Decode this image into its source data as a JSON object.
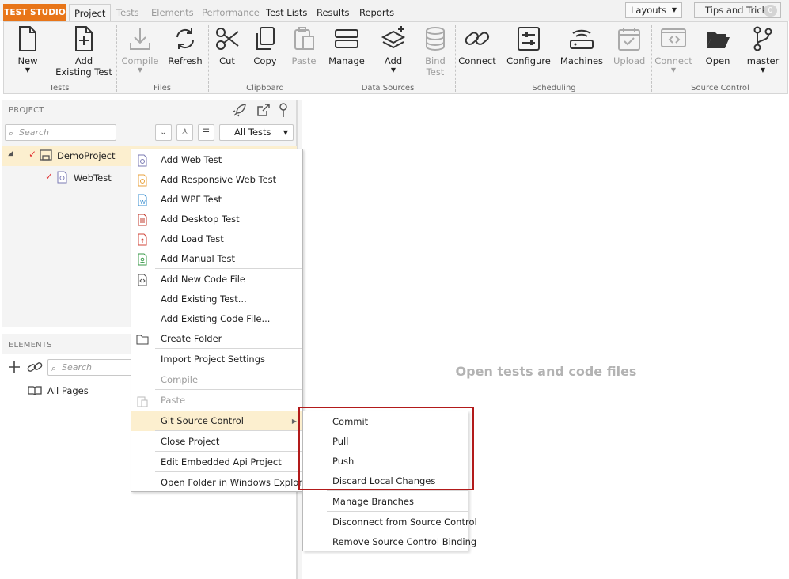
{
  "app": {
    "brand": "TEST STUDIO"
  },
  "tabs": [
    {
      "label": "Project",
      "state": "active"
    },
    {
      "label": "Tests",
      "state": "disabled"
    },
    {
      "label": "Elements",
      "state": "disabled"
    },
    {
      "label": "Performance",
      "state": "disabled"
    },
    {
      "label": "Test Lists",
      "state": "normal"
    },
    {
      "label": "Results",
      "state": "normal"
    },
    {
      "label": "Reports",
      "state": "normal"
    }
  ],
  "topright": {
    "layouts": "Layouts",
    "tips": "Tips and Tricks",
    "tips_count": "0"
  },
  "ribbon": {
    "new": "New",
    "add_existing_1": "Add",
    "add_existing_2": "Existing Test",
    "compile": "Compile",
    "refresh": "Refresh",
    "cut": "Cut",
    "copy": "Copy",
    "paste": "Paste",
    "manage": "Manage",
    "add": "Add",
    "bind_1": "Bind",
    "bind_2": "Test",
    "connect": "Connect",
    "configure": "Configure",
    "machines": "Machines",
    "upload": "Upload",
    "sc_connect": "Connect",
    "open": "Open",
    "master": "master",
    "groups": {
      "tests": "Tests",
      "files": "Files",
      "clipboard": "Clipboard",
      "data_sources": "Data Sources",
      "scheduling": "Scheduling",
      "source_control": "Source Control"
    }
  },
  "project_panel": {
    "title": "PROJECT",
    "search_placeholder": "Search",
    "filter": "All Tests",
    "tree": [
      {
        "label": "DemoProject",
        "level": 0
      },
      {
        "label": "WebTest",
        "level": 1
      }
    ]
  },
  "elements_panel": {
    "title": "ELEMENTS",
    "search_placeholder": "Search",
    "all_pages": "All Pages"
  },
  "main": {
    "placeholder": "Open tests and code files"
  },
  "context_menu": {
    "items": [
      {
        "label": "Add Web Test",
        "icon": "web-test-icon"
      },
      {
        "label": "Add Responsive Web Test",
        "icon": "responsive-test-icon"
      },
      {
        "label": "Add WPF Test",
        "icon": "wpf-test-icon"
      },
      {
        "label": "Add Desktop Test",
        "icon": "desktop-test-icon"
      },
      {
        "label": "Add Load Test",
        "icon": "load-test-icon"
      },
      {
        "label": "Add Manual Test",
        "icon": "manual-test-icon"
      },
      {
        "label": "Add New Code File",
        "icon": "code-file-icon"
      },
      {
        "label": "Add Existing Test...",
        "icon": ""
      },
      {
        "label": "Add Existing Code File...",
        "icon": ""
      },
      {
        "label": "Create Folder",
        "icon": "folder-icon"
      },
      {
        "label": "Import Project Settings",
        "icon": ""
      },
      {
        "label": "Compile",
        "icon": ""
      },
      {
        "label": "Paste",
        "icon": "paste-icon"
      },
      {
        "label": "Git Source Control",
        "icon": ""
      },
      {
        "label": "Close Project",
        "icon": ""
      },
      {
        "label": "Edit Embedded Api Project",
        "icon": ""
      },
      {
        "label": "Open Folder in Windows Explorer",
        "icon": ""
      }
    ]
  },
  "submenu": {
    "items": [
      {
        "label": "Commit"
      },
      {
        "label": "Pull"
      },
      {
        "label": "Push"
      },
      {
        "label": "Discard Local Changes"
      },
      {
        "label": "Manage Branches"
      },
      {
        "label": "Disconnect from Source Control"
      },
      {
        "label": "Remove Source Control Binding"
      }
    ]
  },
  "colors": {
    "brand": "#e87518",
    "highlight_row": "#fcefcf",
    "callout": "#b21a1a"
  }
}
